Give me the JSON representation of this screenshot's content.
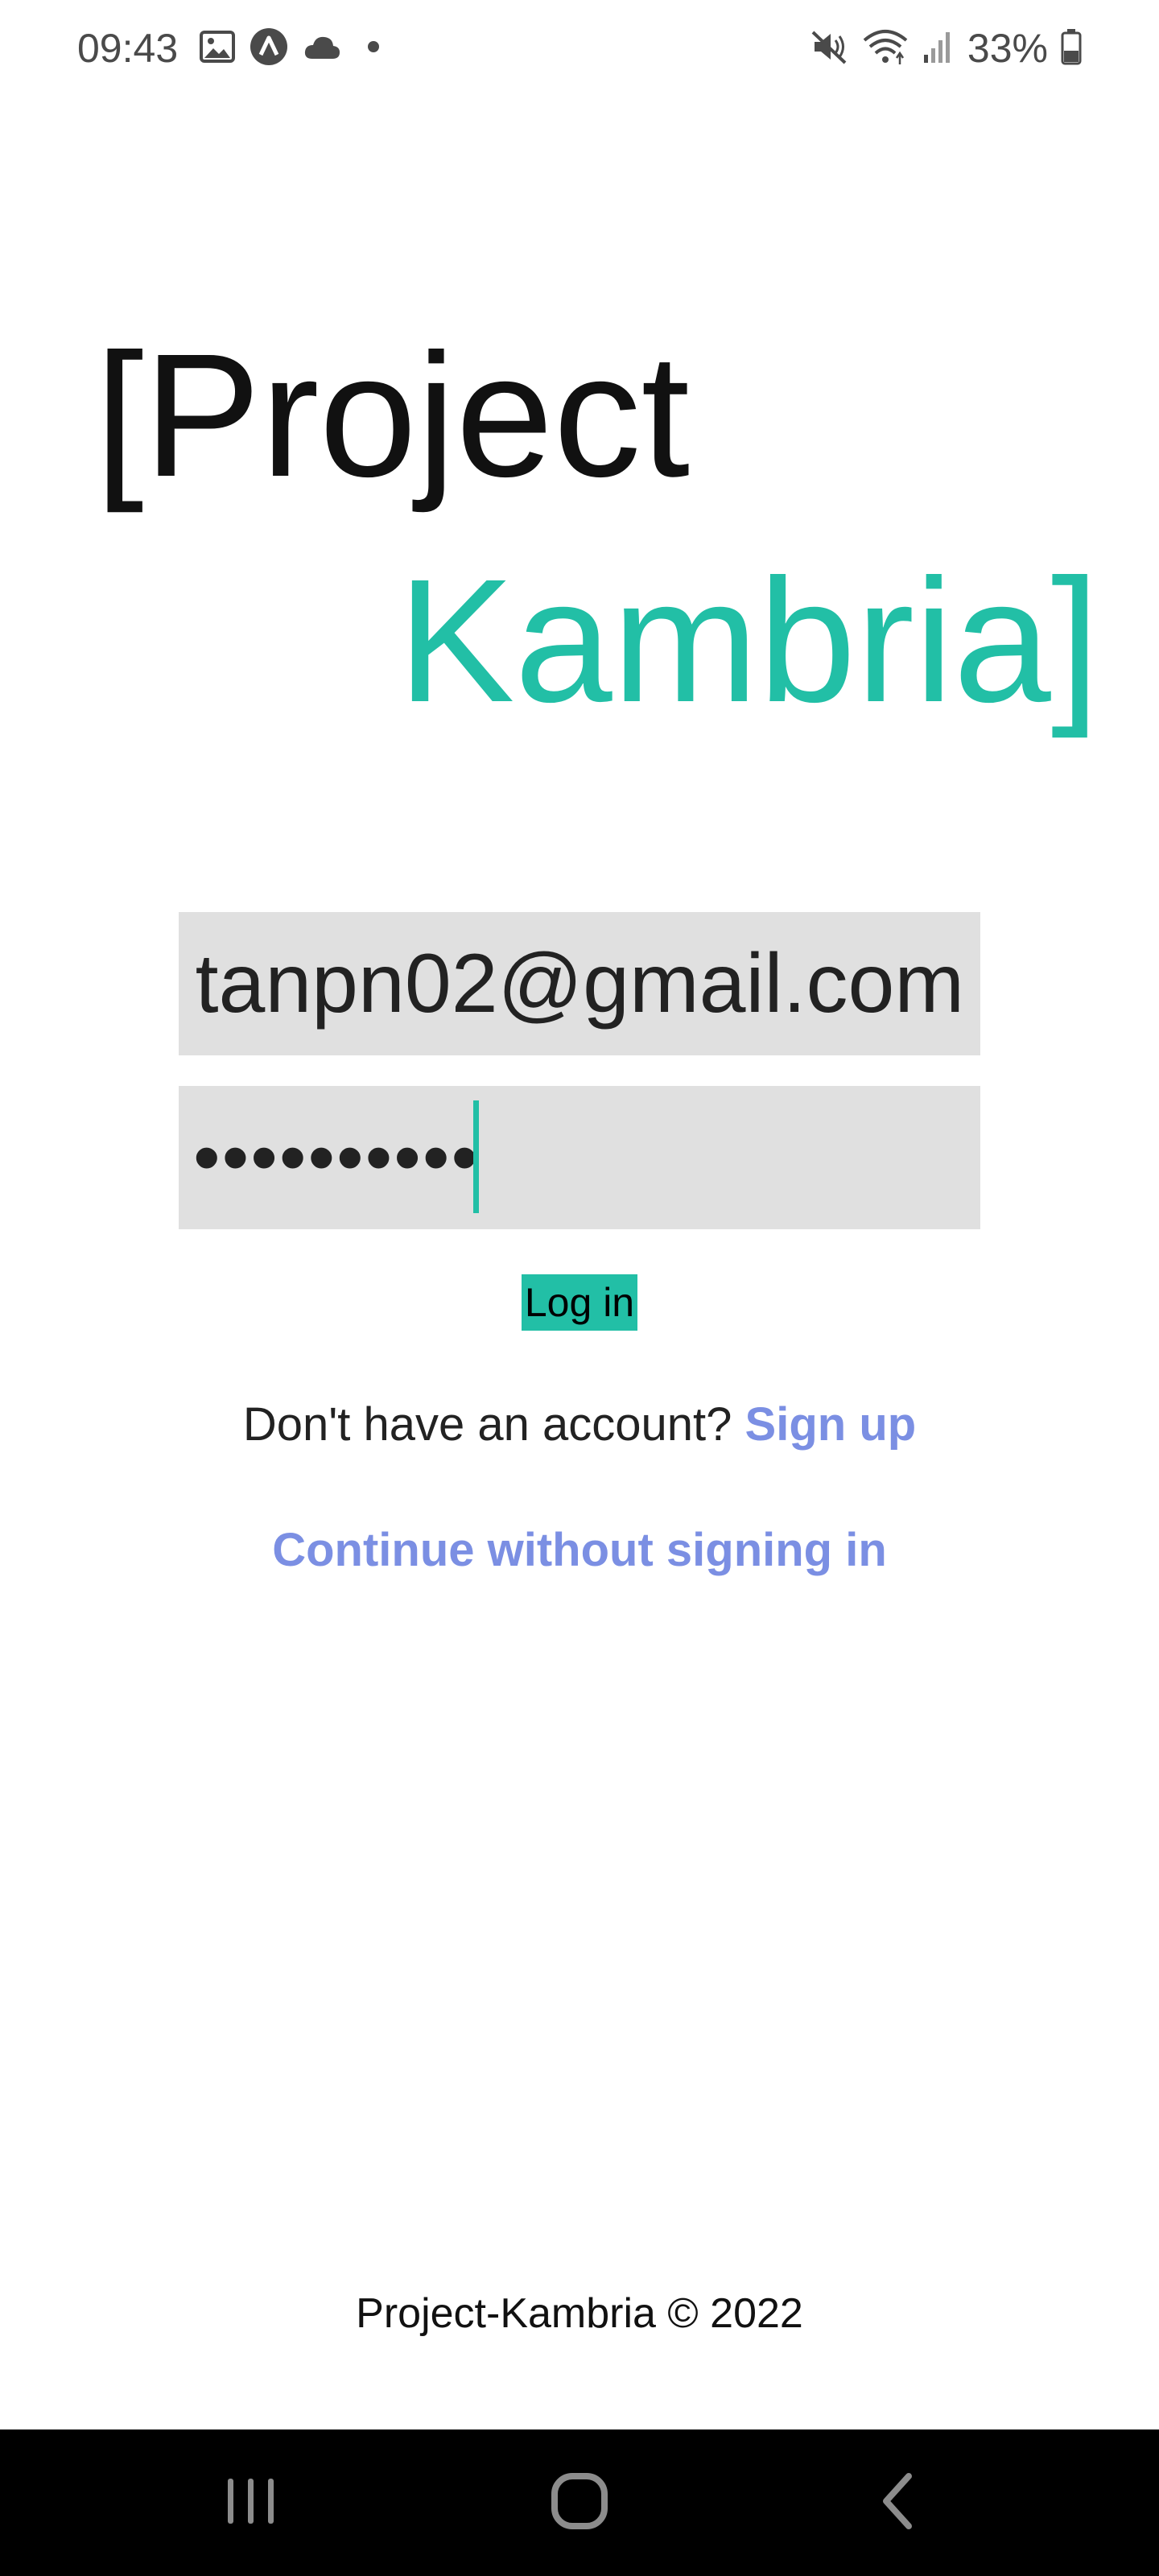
{
  "status_bar": {
    "time": "09:43",
    "battery": "33%",
    "left_icons": [
      "gallery-icon",
      "app-a-icon",
      "cloud-icon",
      "dot-icon"
    ],
    "right_icons": [
      "mute-icon",
      "wifi-icon",
      "signal-icon",
      "battery-icon"
    ]
  },
  "logo": {
    "line1": "[Project",
    "line2": "Kambria]",
    "accent_color": "#22bfa6"
  },
  "form": {
    "email_value": "tanpn02@gmail.com",
    "password_masked": "••••••••••",
    "login_label": "Log in"
  },
  "signup": {
    "prompt": "Don't have an account? ",
    "link": "Sign up",
    "link_color": "#7b8fe3"
  },
  "continue": {
    "label": "Continue without signing in"
  },
  "footer": {
    "text": "Project-Kambria © 2022"
  },
  "nav_bar": {
    "buttons": [
      "recents-icon",
      "home-icon",
      "back-icon"
    ]
  }
}
